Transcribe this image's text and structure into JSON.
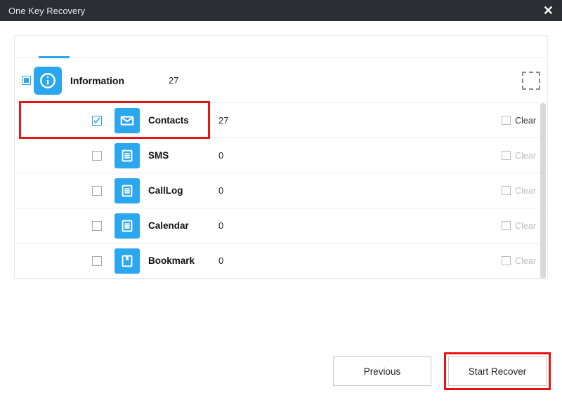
{
  "window": {
    "title": "One Key Recovery"
  },
  "category": {
    "label": "Information",
    "count": "27"
  },
  "items": [
    {
      "label": "Contacts",
      "count": "27",
      "checked": true,
      "clear_enabled": true,
      "icon": "envelope"
    },
    {
      "label": "SMS",
      "count": "0",
      "checked": false,
      "clear_enabled": false,
      "icon": "doc"
    },
    {
      "label": "CallLog",
      "count": "0",
      "checked": false,
      "clear_enabled": false,
      "icon": "doc"
    },
    {
      "label": "Calendar",
      "count": "0",
      "checked": false,
      "clear_enabled": false,
      "icon": "doc"
    },
    {
      "label": "Bookmark",
      "count": "0",
      "checked": false,
      "clear_enabled": false,
      "icon": "bookmark"
    }
  ],
  "labels": {
    "clear": "Clear",
    "previous": "Previous",
    "start_recover": "Start Recover"
  },
  "highlights": {
    "contacts_row": true,
    "start_recover_button": true
  }
}
